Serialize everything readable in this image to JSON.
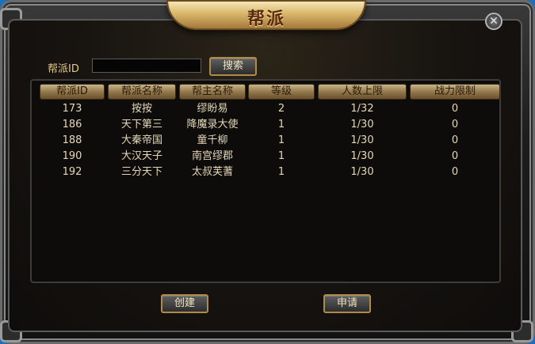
{
  "window": {
    "title": "帮派",
    "close_symbol": "✕"
  },
  "search": {
    "label": "帮派ID",
    "value": "",
    "placeholder": "",
    "button_label": "搜索"
  },
  "table": {
    "headers": [
      "帮派ID",
      "帮派名称",
      "帮主名称",
      "等级",
      "人数上限",
      "战力限制"
    ],
    "rows": [
      [
        "173",
        "按按",
        "缪盼易",
        "2",
        "1/32",
        "0"
      ],
      [
        "186",
        "天下第三",
        "降魔录大使",
        "1",
        "1/30",
        "0"
      ],
      [
        "188",
        "大秦帝国",
        "童千柳",
        "1",
        "1/30",
        "0"
      ],
      [
        "190",
        "大汉天子",
        "南宫缪郡",
        "1",
        "1/30",
        "0"
      ],
      [
        "192",
        "三分天下",
        "太叔芙蓍",
        "1",
        "1/30",
        "0"
      ]
    ]
  },
  "footer": {
    "create_label": "创建",
    "apply_label": "申请"
  },
  "colors": {
    "background": "#1b6fbf",
    "header_gold": "#c9b48a",
    "text": "#e6d7b7",
    "label": "#e2c889"
  },
  "icons": {
    "close": "close-icon"
  }
}
